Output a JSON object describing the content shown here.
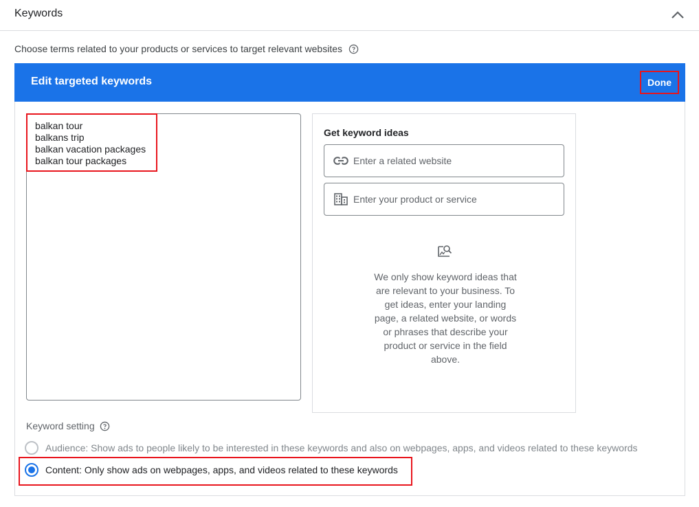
{
  "section": {
    "title": "Keywords",
    "description": "Choose terms related to your products or services to target relevant websites"
  },
  "editor": {
    "title": "Edit targeted keywords",
    "done_label": "Done",
    "accent_color": "#1a73e8",
    "highlight_color": "#e8141c",
    "keywords": [
      "balkan tour",
      "balkans trip",
      "balkan vacation packages",
      "balkan tour packages"
    ]
  },
  "ideas": {
    "title": "Get keyword ideas",
    "website_placeholder": "Enter a related website",
    "website_icon": "link-icon",
    "product_placeholder": "Enter your product or service",
    "product_icon": "business-icon",
    "empty_icon": "image-search-icon",
    "empty_message": "We only show keyword ideas that are relevant to your business. To get ideas, enter your landing page, a related website, or words or phrases that describe your product or service in the field above."
  },
  "keyword_setting": {
    "label": "Keyword setting",
    "options": [
      {
        "label": "Audience: Show ads to people likely to be interested in these keywords and also on webpages, apps, and videos related to these keywords",
        "selected": false
      },
      {
        "label": "Content: Only show ads on webpages, apps, and videos related to these keywords",
        "selected": true
      }
    ]
  }
}
